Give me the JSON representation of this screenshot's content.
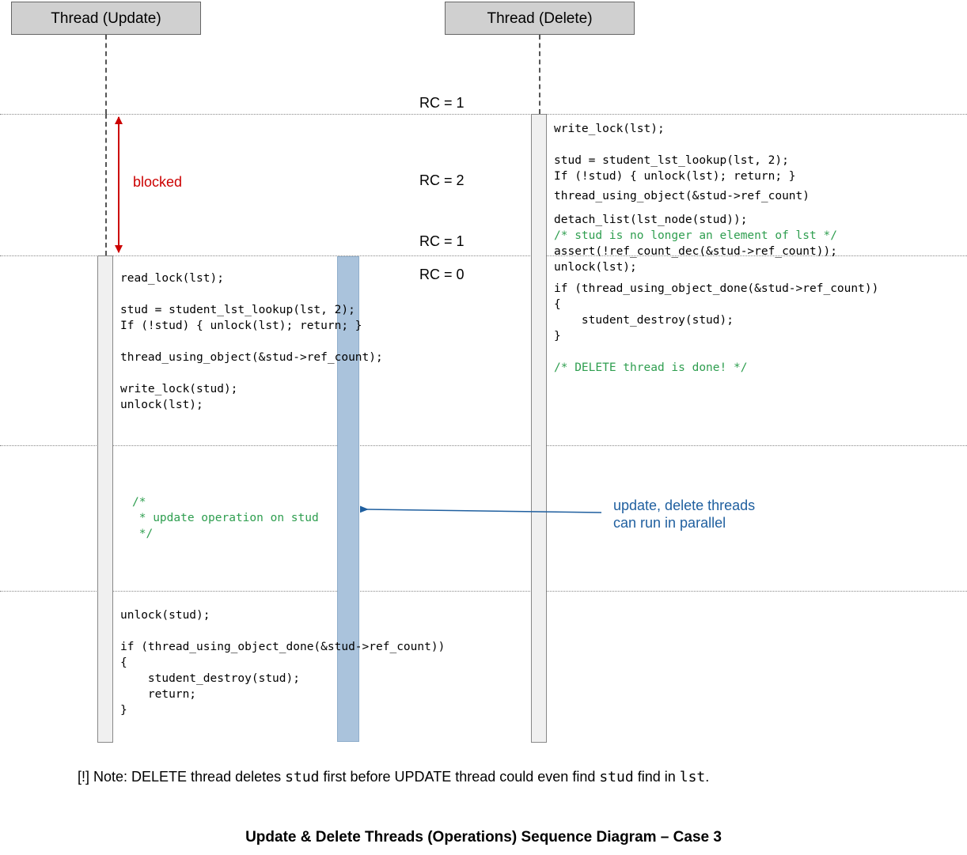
{
  "headers": {
    "update": "Thread (Update)",
    "delete": "Thread (Delete)"
  },
  "rc": {
    "r1": "RC = 1",
    "r2": "RC = 2",
    "r1b": "RC = 1",
    "r0": "RC = 0"
  },
  "blocked": "blocked",
  "code": {
    "delete_block1_l1": "write_lock(lst);",
    "delete_block1_l2": "",
    "delete_block1_l3": "stud = student_lst_lookup(lst, 2);",
    "delete_block1_l4": "If (!stud) { unlock(lst); return; }",
    "delete_block2_l1": "thread_using_object(&stud->ref_count)",
    "delete_block3_l1": "detach_list(lst_node(stud));",
    "delete_block3_c1": "/* stud is no longer an element of lst */",
    "delete_block3_l2": "assert(!ref_count_dec(&stud->ref_count));",
    "delete_block3_l3": "unlock(lst);",
    "delete_block4_l1": "if (thread_using_object_done(&stud->ref_count))",
    "delete_block4_l2": "{",
    "delete_block4_l3": "    student_destroy(stud);",
    "delete_block4_l4": "}",
    "delete_block4_l5": "",
    "delete_block4_c1": "/* DELETE thread is done! */",
    "update_block1_l1": "read_lock(lst);",
    "update_block1_l2": "",
    "update_block1_l3": "stud = student_lst_lookup(lst, 2);",
    "update_block1_l4": "If (!stud) { unlock(lst); return; }",
    "update_block1_l5": "",
    "update_block1_l6": "thread_using_object(&stud->ref_count);",
    "update_block1_l7": "",
    "update_block1_l8": "write_lock(stud);",
    "update_block1_l9": "unlock(lst);",
    "update_block2_c1": "/*",
    "update_block2_c2": " * update operation on stud",
    "update_block2_c3": " */",
    "update_block3_l1": "unlock(stud);",
    "update_block3_l2": "",
    "update_block3_l3": "if (thread_using_object_done(&stud->ref_count))",
    "update_block3_l4": "{",
    "update_block3_l5": "    student_destroy(stud);",
    "update_block3_l6": "    return;",
    "update_block3_l7": "}"
  },
  "annotation": "update, delete threads\ncan run in parallel",
  "note_prefix": "[!] Note: DELETE thread deletes ",
  "note_stud1": "stud",
  "note_mid": " first before UPDATE thread could even find ",
  "note_stud2": "stud",
  "note_mid2": " find in ",
  "note_lst": "lst",
  "note_period": ".",
  "title": "Update & Delete Threads (Operations) Sequence Diagram – Case 3"
}
